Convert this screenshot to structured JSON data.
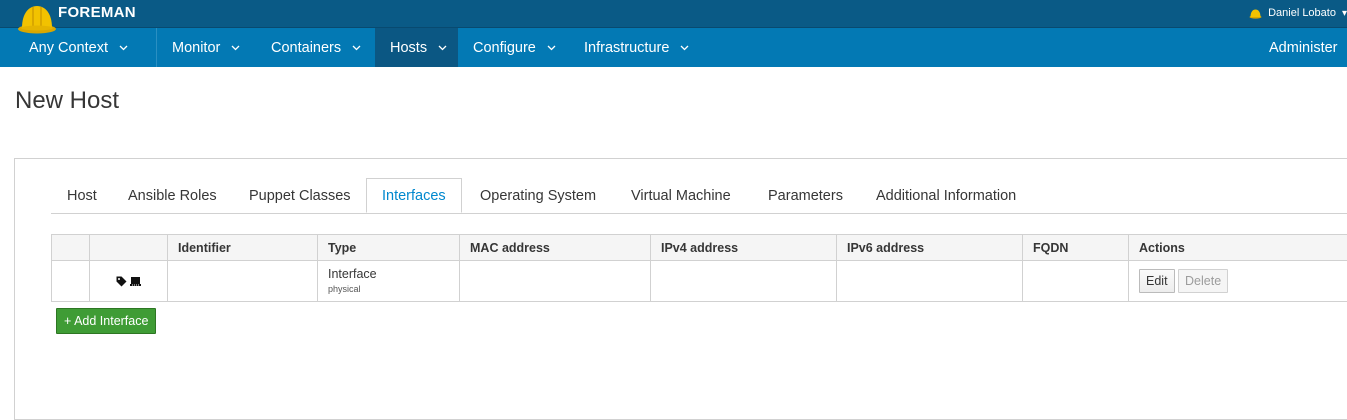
{
  "header": {
    "brand": "FOREMAN",
    "user": "Daniel Lobato"
  },
  "nav": {
    "items": [
      {
        "label": "Any Context"
      },
      {
        "label": "Monitor"
      },
      {
        "label": "Containers"
      },
      {
        "label": "Hosts"
      },
      {
        "label": "Configure"
      },
      {
        "label": "Infrastructure"
      },
      {
        "label": "Administer"
      }
    ],
    "active": "Hosts"
  },
  "page": {
    "title": "New Host"
  },
  "tabs": [
    {
      "label": "Host"
    },
    {
      "label": "Ansible Roles"
    },
    {
      "label": "Puppet Classes"
    },
    {
      "label": "Interfaces"
    },
    {
      "label": "Operating System"
    },
    {
      "label": "Virtual Machine"
    },
    {
      "label": "Parameters"
    },
    {
      "label": "Additional Information"
    }
  ],
  "active_tab": "Interfaces",
  "table": {
    "columns": [
      "",
      "",
      "Identifier",
      "Type",
      "MAC address",
      "IPv4 address",
      "IPv6 address",
      "FQDN",
      "Actions"
    ],
    "rows": [
      {
        "identifier": "",
        "type": "Interface",
        "type_sub": "physical",
        "mac": "",
        "ipv4": "",
        "ipv6": "",
        "fqdn": "",
        "edit_label": "Edit",
        "delete_label": "Delete",
        "icons": [
          "tag-icon",
          "nic-icon"
        ]
      }
    ]
  },
  "add_interface_label": "+ Add Interface",
  "colors": {
    "header": "#0a5a86",
    "nav": "#0379b4",
    "nav_active": "#0b5783",
    "tab_active": "#0088ce",
    "add_button": "#3f9c35"
  }
}
